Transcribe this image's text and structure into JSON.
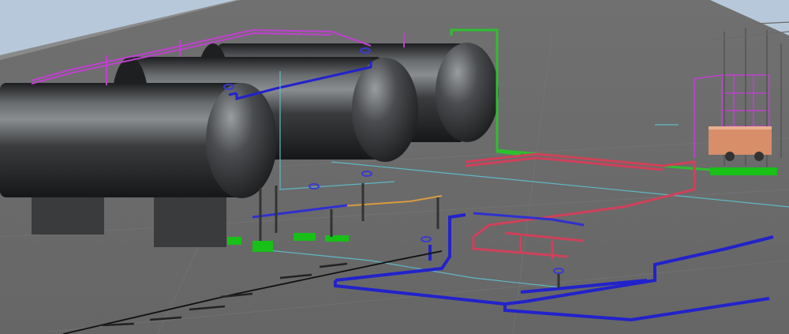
{
  "scene": {
    "description_visible_text": "",
    "colors": {
      "sky": "#b7c8da",
      "ground": "#6f6f6f",
      "tank": "#2b2d2f",
      "pipe_blue": "#2222cc",
      "pipe_red": "#d0405a",
      "pipe_green": "#2fbf2f",
      "pipe_magenta": "#c040d0",
      "pipe_cyan": "#5fb8c8",
      "pipe_orange": "#d89a40",
      "pad_green": "#18c018",
      "cable_black": "#111111",
      "building_orange": "#d98e6a"
    },
    "tanks": [
      {
        "name": "tank-front"
      },
      {
        "name": "tank-middle"
      },
      {
        "name": "tank-rear"
      }
    ],
    "structures": [
      {
        "name": "pipe-rack-structure"
      },
      {
        "name": "loading-skid"
      }
    ]
  }
}
